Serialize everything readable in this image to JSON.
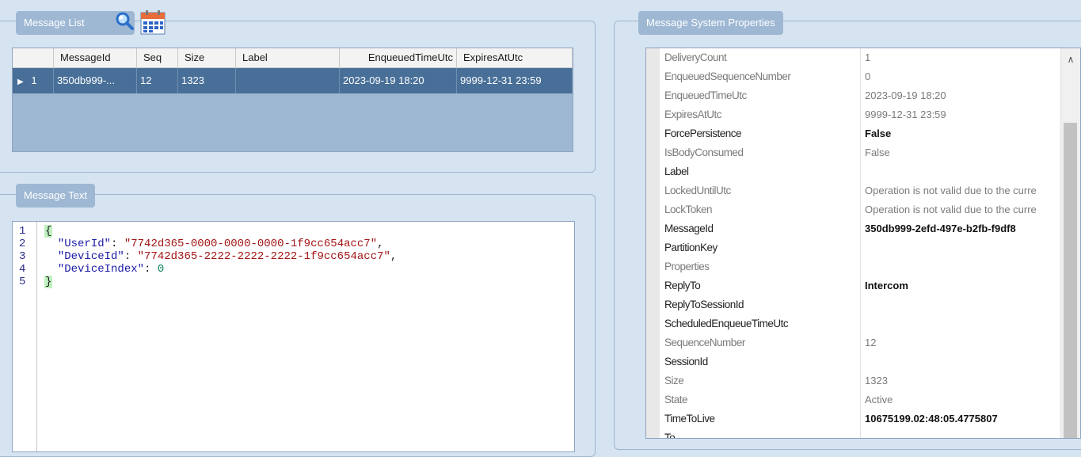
{
  "message_list": {
    "title": "Message List",
    "columns": [
      "MessageId",
      "Seq",
      "Size",
      "Label",
      "EnqueuedTimeUtc",
      "ExpiresAtUtc"
    ],
    "rows": [
      {
        "row_num": "1",
        "indicator": "▶",
        "message_id": "350db999-...",
        "seq": "12",
        "size": "1323",
        "label": "",
        "enqueued": "2023-09-19 18:20",
        "expires": "9999-12-31 23:59"
      }
    ]
  },
  "message_text": {
    "title": "Message Text",
    "line_numbers": [
      "1",
      "2",
      "3",
      "4",
      "5"
    ],
    "lines": {
      "open_brace": "{",
      "user_key": "\"UserId\"",
      "user_val": "\"7742d365-0000-0000-0000-1f9cc654acc7\"",
      "device_key": "\"DeviceId\"",
      "device_val": "\"7742d365-2222-2222-2222-1f9cc654acc7\"",
      "index_key": "\"DeviceIndex\"",
      "index_val": "0",
      "close_brace": "}"
    }
  },
  "properties": {
    "title": "Message System Properties",
    "rows": [
      {
        "name": "DeliveryCount",
        "value": "1",
        "name_style": "dim",
        "value_style": "dim"
      },
      {
        "name": "EnqueuedSequenceNumber",
        "value": "0",
        "name_style": "dim",
        "value_style": "dim"
      },
      {
        "name": "EnqueuedTimeUtc",
        "value": "2023-09-19 18:20",
        "name_style": "dim",
        "value_style": "dim"
      },
      {
        "name": "ExpiresAtUtc",
        "value": "9999-12-31 23:59",
        "name_style": "dim",
        "value_style": "dim"
      },
      {
        "name": "ForcePersistence",
        "value": "False",
        "name_style": "",
        "value_style": "bold"
      },
      {
        "name": "IsBodyConsumed",
        "value": "False",
        "name_style": "dim",
        "value_style": "dim"
      },
      {
        "name": "Label",
        "value": "",
        "name_style": "",
        "value_style": ""
      },
      {
        "name": "LockedUntilUtc",
        "value": "Operation is not valid due to the curre",
        "name_style": "dim",
        "value_style": "dim"
      },
      {
        "name": "LockToken",
        "value": "Operation is not valid due to the curre",
        "name_style": "dim",
        "value_style": "dim"
      },
      {
        "name": "MessageId",
        "value": "350db999-2efd-497e-b2fb-f9df8",
        "name_style": "",
        "value_style": "bold"
      },
      {
        "name": "PartitionKey",
        "value": "",
        "name_style": "",
        "value_style": ""
      },
      {
        "name": "Properties",
        "value": "",
        "name_style": "dim",
        "value_style": ""
      },
      {
        "name": "ReplyTo",
        "value": "Intercom",
        "name_style": "",
        "value_style": "bold"
      },
      {
        "name": "ReplyToSessionId",
        "value": "",
        "name_style": "",
        "value_style": ""
      },
      {
        "name": "ScheduledEnqueueTimeUtc",
        "value": "",
        "name_style": "",
        "value_style": ""
      },
      {
        "name": "SequenceNumber",
        "value": "12",
        "name_style": "dim",
        "value_style": "dim"
      },
      {
        "name": "SessionId",
        "value": "",
        "name_style": "",
        "value_style": ""
      },
      {
        "name": "Size",
        "value": "1323",
        "name_style": "dim",
        "value_style": "dim"
      },
      {
        "name": "State",
        "value": "Active",
        "name_style": "dim",
        "value_style": "dim"
      },
      {
        "name": "TimeToLive",
        "value": "10675199.02:48:05.4775807",
        "name_style": "",
        "value_style": "bold"
      },
      {
        "name": "To",
        "value": "",
        "name_style": "",
        "value_style": ""
      }
    ]
  },
  "icons": {
    "search": "magnifier-icon",
    "calendar": "calendar-icon",
    "scroll_up": "chevron-up-icon"
  }
}
